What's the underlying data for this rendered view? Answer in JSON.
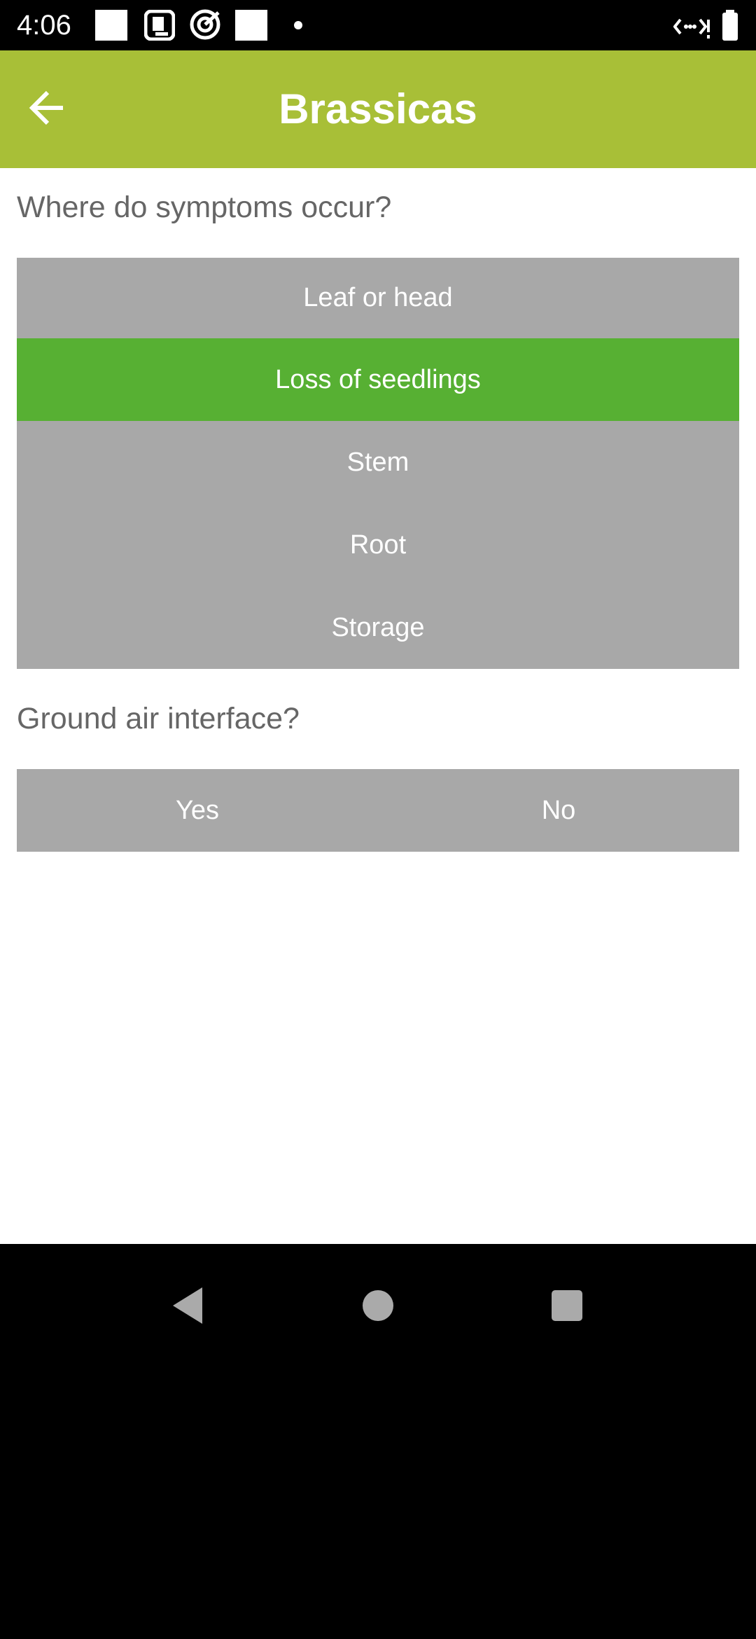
{
  "status_bar": {
    "time": "4:06",
    "icons": [
      "white-square-icon",
      "d-app-icon",
      "target-icon",
      "white-square-icon",
      "dot-icon",
      "data-signal-icon",
      "battery-icon"
    ]
  },
  "app_bar": {
    "title": "Brassicas",
    "back_icon": "arrow-left-icon",
    "background_color": "#a8bf37"
  },
  "questions": [
    {
      "text": "Where do symptoms occur?",
      "options": [
        {
          "label": "Leaf or head",
          "selected": false
        },
        {
          "label": "Loss of seedlings",
          "selected": true
        },
        {
          "label": "Stem",
          "selected": false
        },
        {
          "label": "Root",
          "selected": false
        },
        {
          "label": "Storage",
          "selected": false
        }
      ]
    },
    {
      "text": "Ground air interface?",
      "options": [
        {
          "label": "Yes",
          "selected": false
        },
        {
          "label": "No",
          "selected": false
        }
      ]
    }
  ],
  "colors": {
    "option_default": "#a8a8a8",
    "option_selected": "#57b033",
    "question_text": "#666666"
  },
  "nav_bar": {
    "icons": [
      "back-triangle-icon",
      "home-circle-icon",
      "recents-square-icon"
    ]
  }
}
